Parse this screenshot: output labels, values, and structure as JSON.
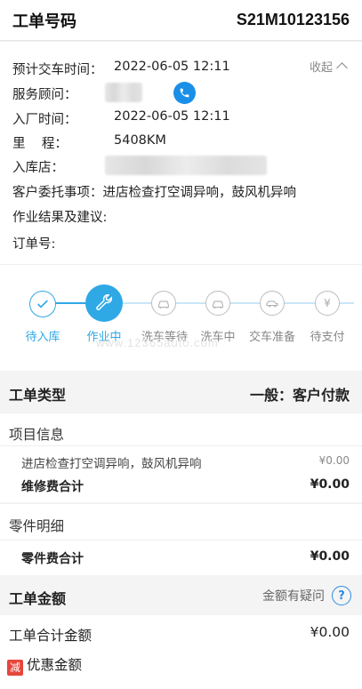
{
  "header": {
    "title": "工单号码",
    "order_no": "S21M10123156"
  },
  "info": {
    "collapse_label": "收起",
    "rows": [
      {
        "label": "预计交车时间：",
        "value": "2022-06-05 12:11"
      },
      {
        "label": "服务顾问：",
        "value": ""
      },
      {
        "label": "入厂时间：",
        "value": "2022-06-05 12:11"
      },
      {
        "label": "里    程：",
        "value": "5408KM"
      },
      {
        "label": "入库店：",
        "value": ""
      },
      {
        "label": "客户委托事项：",
        "value": "进店检查打空调异响，鼓风机异响"
      },
      {
        "label": "作业结果及建议:",
        "value": ""
      },
      {
        "label": "订单号:",
        "value": ""
      }
    ]
  },
  "progress": {
    "steps": [
      {
        "label": "待入库",
        "icon": "check-icon",
        "state": "done"
      },
      {
        "label": "作业中",
        "icon": "wrench-icon",
        "state": "current"
      },
      {
        "label": "洗车等待",
        "icon": "car-icon",
        "state": "pending"
      },
      {
        "label": "洗车中",
        "icon": "car-icon",
        "state": "pending"
      },
      {
        "label": "交车准备",
        "icon": "car-side-icon",
        "state": "pending"
      },
      {
        "label": "待支付",
        "icon": "yen-icon",
        "state": "pending"
      }
    ],
    "watermark": "www.12365auto.com"
  },
  "order_type": {
    "label": "工单类型",
    "value": "一般：客户付款"
  },
  "items": {
    "title": "项目信息",
    "entries": [
      {
        "name": "进店检查打空调异响，鼓风机异响",
        "price": "¥0.00"
      }
    ],
    "subtotal_label": "维修费合计",
    "subtotal": "¥0.00"
  },
  "parts": {
    "title": "零件明细",
    "subtotal_label": "零件费合计",
    "subtotal": "¥0.00"
  },
  "amount": {
    "title": "工单金额",
    "question_label": "金额有疑问",
    "total_label": "工单合计金额",
    "total": "¥0.00",
    "discount_badge": "减",
    "discount_label": "优惠金额"
  },
  "colors": {
    "accent": "#2b8ce8",
    "done": "#2fa8e6",
    "pending": "#bdbdbd"
  }
}
